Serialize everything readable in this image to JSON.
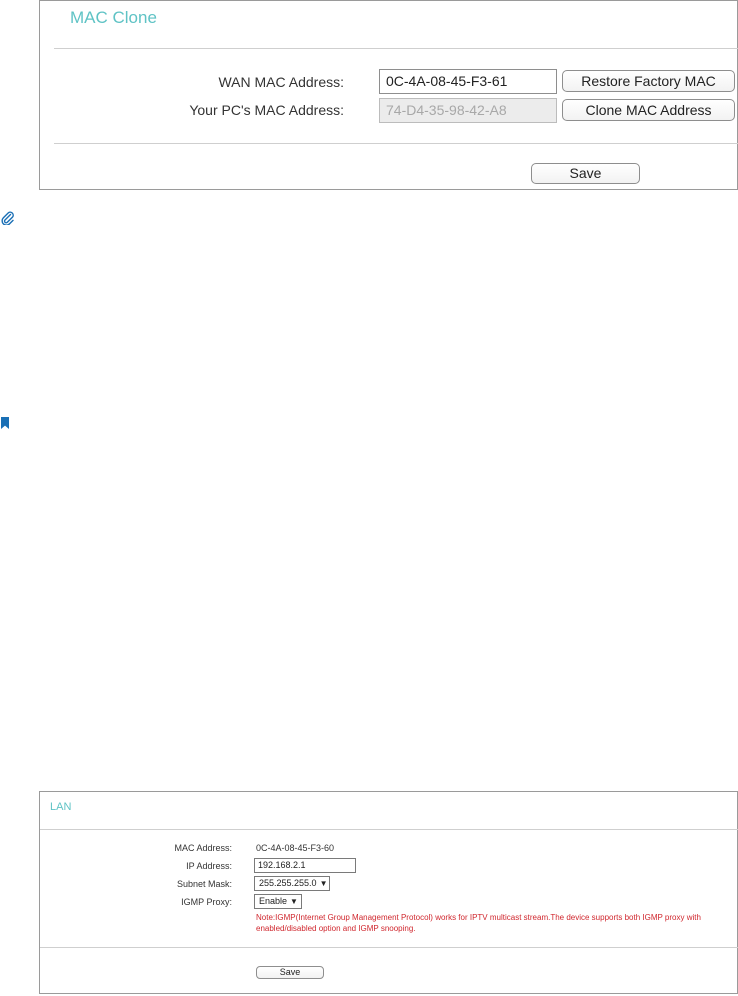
{
  "mac_clone": {
    "title": "MAC Clone",
    "wan_mac_label": "WAN MAC Address:",
    "wan_mac_value": "0C-4A-08-45-F3-61",
    "restore_button": "Restore Factory MAC",
    "pc_mac_label": "Your PC's MAC Address:",
    "pc_mac_value": "74-D4-35-98-42-A8",
    "clone_button": "Clone MAC Address",
    "save_button": "Save"
  },
  "side_icons": {
    "note_icon": "paperclip-icon",
    "tip_icon": "bookmark-icon",
    "color": "#1a6fb5"
  },
  "lan": {
    "title": "LAN",
    "mac_label": "MAC Address:",
    "mac_value": "0C-4A-08-45-F3-60",
    "ip_label": "IP Address:",
    "ip_value": "192.168.2.1",
    "subnet_label": "Subnet Mask:",
    "subnet_value": "255.255.255.0",
    "igmp_label": "IGMP Proxy:",
    "igmp_value": "Enable",
    "note_line1": "Note:IGMP(Internet Group Management Protocol) works for IPTV multicast stream.The device supports both IGMP proxy with",
    "note_line2": "enabled/disabled option and IGMP snooping.",
    "save_button": "Save"
  },
  "colors": {
    "title_accent": "#5fc3c5",
    "note_red": "#d0272e"
  }
}
